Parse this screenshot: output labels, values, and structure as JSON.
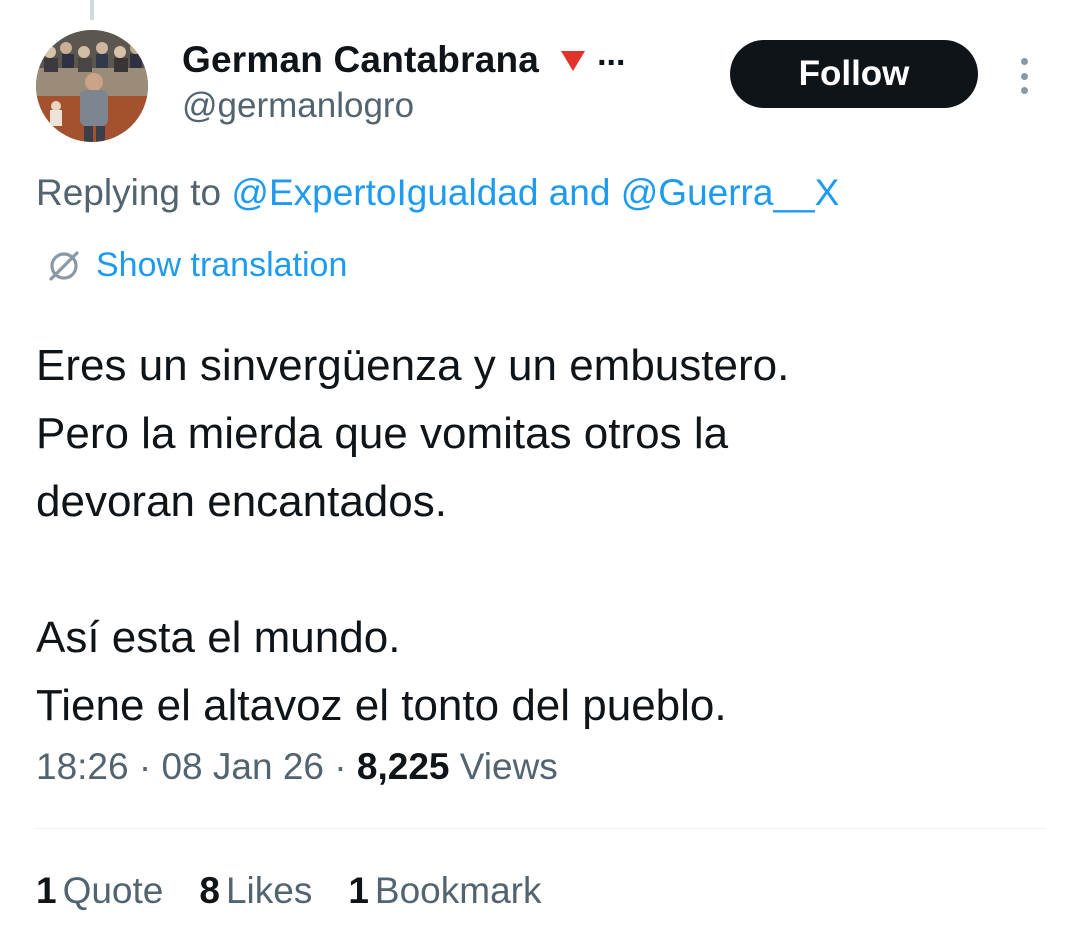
{
  "tweet": {
    "author": {
      "display_name": "German Cantabrana",
      "handle": "@germanlogro",
      "badge_icon": "red-triangle-icon",
      "truncation": "..."
    },
    "follow_label": "Follow",
    "replying": {
      "prefix": "Replying to",
      "user1": "@ExpertoIgualdad",
      "conjunction": "and",
      "user2": "@Guerra__X"
    },
    "show_translation": "Show translation",
    "text_lines": [
      "Eres un sinvergüenza y un embustero.",
      "Pero la mierda que vomitas otros la",
      "devoran encantados.",
      "Así esta el mundo.",
      "Tiene el altavoz el tonto del pueblo."
    ],
    "time": "18:26",
    "separator": "·",
    "date": "08 Jan 26",
    "views_count": "8,225",
    "views_label": "Views",
    "stats": {
      "quotes_count": "1",
      "quotes_label": "Quote",
      "likes_count": "8",
      "likes_label": "Likes",
      "bookmarks_count": "1",
      "bookmarks_label": "Bookmark"
    }
  },
  "colors": {
    "link": "#1d9bf0",
    "secondary_text": "#536471",
    "primary_text": "#0f1419",
    "follow_bg": "#0f1419",
    "badge": "#e0332b"
  }
}
